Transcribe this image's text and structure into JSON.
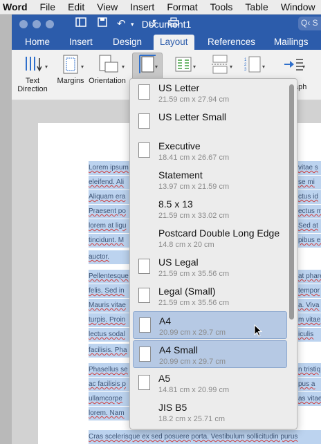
{
  "menubar": {
    "app": "Word",
    "items": [
      "File",
      "Edit",
      "View",
      "Insert",
      "Format",
      "Tools",
      "Table",
      "Window"
    ]
  },
  "window": {
    "title": "Document1",
    "search_placeholder": "Q‹ S"
  },
  "tabs": [
    {
      "label": "Home",
      "active": false
    },
    {
      "label": "Insert",
      "active": false
    },
    {
      "label": "Design",
      "active": false
    },
    {
      "label": "Layout",
      "active": true
    },
    {
      "label": "References",
      "active": false
    },
    {
      "label": "Mailings",
      "active": false
    }
  ],
  "ribbon": {
    "text_direction": "Text Direction",
    "margins": "Margins",
    "orientation": "Orientation",
    "paragraph_partial": "aph"
  },
  "colors": {
    "brand_blue": "#2c5cab",
    "highlight": "#b6c9e4",
    "selection": "#bcd3ef"
  },
  "paper_sizes": [
    {
      "name": "US Letter",
      "dims": "21.59 cm x 27.94 cm",
      "checkbox": true
    },
    {
      "name": "US Letter Small",
      "dims": "",
      "checkbox": true
    },
    {
      "name": "Executive",
      "dims": "18.41 cm x 26.67 cm",
      "checkbox": true
    },
    {
      "name": "Statement",
      "dims": "13.97 cm x 21.59 cm",
      "checkbox": false
    },
    {
      "name": "8.5 x 13",
      "dims": "21.59 cm x 33.02 cm",
      "checkbox": false
    },
    {
      "name": "Postcard Double Long Edge",
      "dims": "14.8 cm x 20 cm",
      "checkbox": false
    },
    {
      "name": "US Legal",
      "dims": "21.59 cm x 35.56 cm",
      "checkbox": true
    },
    {
      "name": "Legal (Small)",
      "dims": "21.59 cm x 35.56 cm",
      "checkbox": true
    },
    {
      "name": "A4",
      "dims": "20.99 cm x 29.7 cm",
      "checkbox": true,
      "highlighted": true
    },
    {
      "name": "A4 Small",
      "dims": "20.99 cm x 29.7 cm",
      "checkbox": true,
      "highlighted": true
    },
    {
      "name": "A5",
      "dims": "14.81 cm x 20.99 cm",
      "checkbox": true
    },
    {
      "name": "JIS B5",
      "dims": "18.2 cm x 25.71 cm",
      "checkbox": false
    }
  ],
  "document_lines": [
    {
      "left": "Lorem ipsum",
      "right": "vitae s"
    },
    {
      "left": "eleifend. Ali",
      "right": "se mi"
    },
    {
      "left": "Aliquam era",
      "right": "ctus id"
    },
    {
      "left": "Praesent po",
      "right": "ectus ma"
    },
    {
      "left": "lorem at ligu",
      "right": "Sed at"
    },
    {
      "left": "tincidunt. M",
      "right": "pibus en"
    },
    {
      "left": "auctor.",
      "right": ""
    },
    {
      "left": "Pellentesque",
      "right": "at pharet"
    },
    {
      "left": "felis. Sed in",
      "right": "tempor"
    },
    {
      "left": "Mauris vitae",
      "right": "a. Viva"
    },
    {
      "left": "turpis. Proin",
      "right": "m vitae"
    },
    {
      "left": "lectus sodal",
      "right": "iculis"
    },
    {
      "left": "facilisis. Pha",
      "right": ""
    },
    {
      "left": "Phasellus se",
      "right": "n tristiq"
    },
    {
      "left": "ac facilisis p",
      "right": "pus a"
    },
    {
      "left": "ullamcorpe",
      "right": "as vitae"
    },
    {
      "left": "lorem. Nam",
      "right": ""
    },
    {
      "left": "Cras scelerisque ex sed posuere porta. Vestibulum sollicitudin purus",
      "right": ""
    }
  ]
}
